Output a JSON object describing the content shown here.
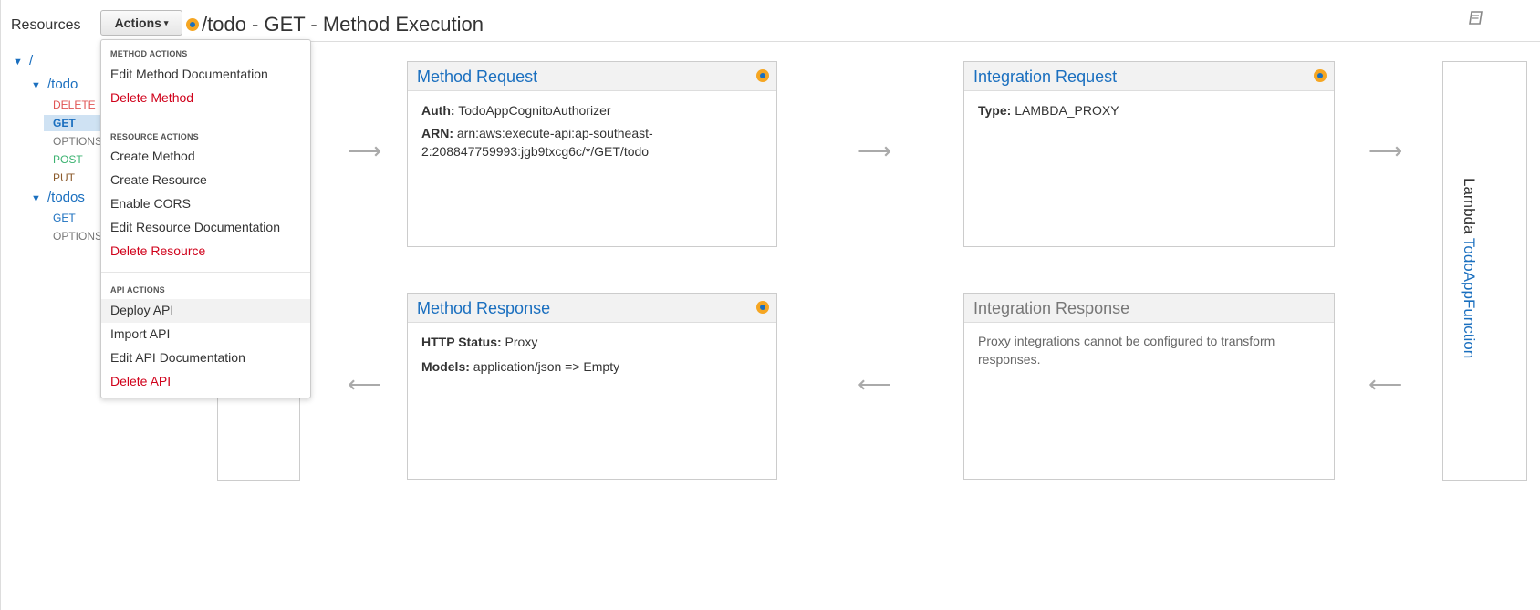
{
  "sidebar": {
    "title": "Resources",
    "actions_label": "Actions",
    "tree": [
      {
        "path": "/",
        "methods": []
      },
      {
        "path": "/todo",
        "methods": [
          "DELETE",
          "GET",
          "OPTIONS",
          "POST",
          "PUT"
        ]
      },
      {
        "path": "/todos",
        "methods": [
          "GET",
          "OPTIONS"
        ]
      }
    ],
    "selected": "GET"
  },
  "header": {
    "title": "/todo - GET - Method Execution"
  },
  "dropdown": {
    "method_actions_header": "METHOD ACTIONS",
    "method_actions": [
      "Edit Method Documentation",
      "Delete Method"
    ],
    "resource_actions_header": "RESOURCE ACTIONS",
    "resource_actions": [
      "Create Method",
      "Create Resource",
      "Enable CORS",
      "Edit Resource Documentation",
      "Delete Resource"
    ],
    "api_actions_header": "API ACTIONS",
    "api_actions": [
      "Deploy API",
      "Import API",
      "Edit API Documentation",
      "Delete API"
    ]
  },
  "method_request": {
    "title": "Method Request",
    "auth_label": "Auth:",
    "auth_value": "TodoAppCognitoAuthorizer",
    "arn_label": "ARN:",
    "arn_value_1": "arn:aws:execute-api:ap-southeast-",
    "arn_value_2": "2:208847759993:jgb9txcg6c/*/GET/todo"
  },
  "integration_request": {
    "title": "Integration Request",
    "type_label": "Type:",
    "type_value": "LAMBDA_PROXY"
  },
  "method_response": {
    "title": "Method Response",
    "status_label": "HTTP Status:",
    "status_value": "Proxy",
    "models_label": "Models:",
    "models_value": "application/json => Empty"
  },
  "integration_response": {
    "title": "Integration Response",
    "note_1": "Proxy integrations cannot be configured to transform",
    "note_2": "responses."
  },
  "lambda": {
    "prefix": "Lambda",
    "function_name": "TodoAppFunction"
  },
  "colors": {
    "link": "#1a6fbf",
    "danger": "#d0021b",
    "post": "#3cb371",
    "put": "#8b5a2b",
    "badge": "#f5a623"
  }
}
